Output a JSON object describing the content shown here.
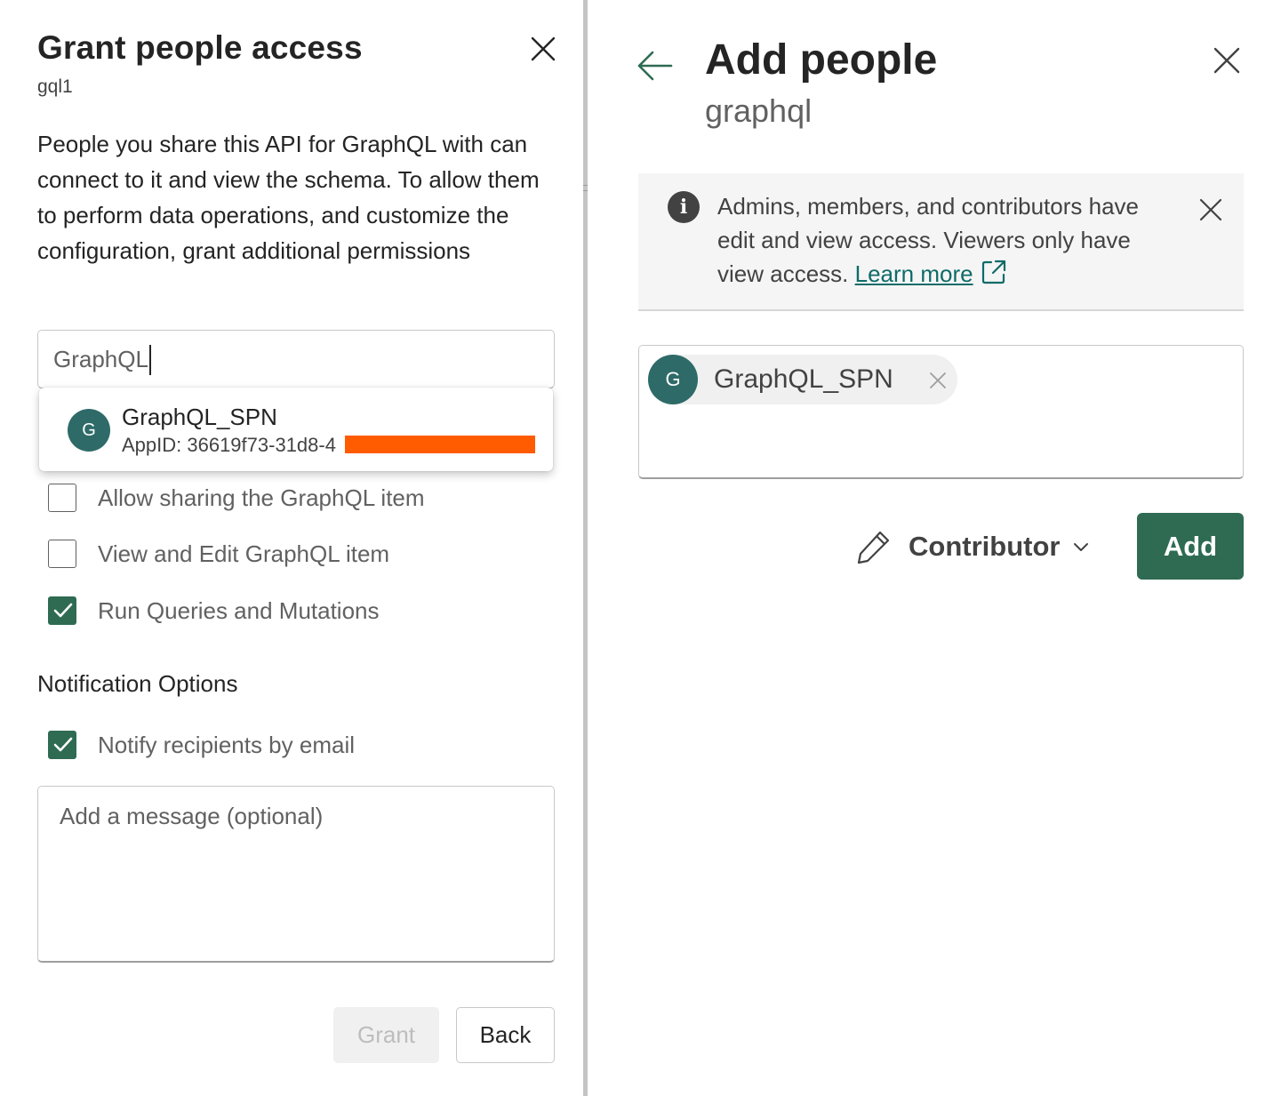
{
  "left_panel": {
    "title": "Grant people access",
    "subtitle": "gql1",
    "description": "People you share this API for GraphQL with can connect to it and view the schema. To allow them to perform data operations, and customize the configuration, grant additional permissions",
    "search": {
      "value": "GraphQL",
      "placeholder": ""
    },
    "suggestion": {
      "avatar_initial": "G",
      "name": "GraphQL_SPN",
      "app_id": "AppID: 36619f73-31d8-4"
    },
    "permissions": [
      {
        "label": "Allow sharing the GraphQL item",
        "checked": false
      },
      {
        "label": "View and Edit GraphQL item",
        "checked": false
      },
      {
        "label": "Run Queries and Mutations",
        "checked": true
      }
    ],
    "notification_heading": "Notification Options",
    "notify_email": {
      "label": "Notify recipients by email",
      "checked": true
    },
    "message_placeholder": "Add a message (optional)",
    "grant_label": "Grant",
    "back_label": "Back"
  },
  "right_panel": {
    "title": "Add people",
    "subtitle": "graphql",
    "info": {
      "text": "Admins, members, and contributors have edit and view access. Viewers only have view access.",
      "link": "Learn more"
    },
    "chip": {
      "avatar_initial": "G",
      "name": "GraphQL_SPN"
    },
    "role_label": "Contributor",
    "add_label": "Add"
  },
  "colors": {
    "accent": "#2e6b52",
    "avatar": "#2e6b68",
    "link": "#0f6b68",
    "redaction": "#ff5b00"
  },
  "icons": [
    "close-icon",
    "check-icon",
    "back-arrow-icon",
    "info-icon",
    "external-link-icon",
    "pencil-icon",
    "chevron-down-icon",
    "dismiss-icon"
  ]
}
